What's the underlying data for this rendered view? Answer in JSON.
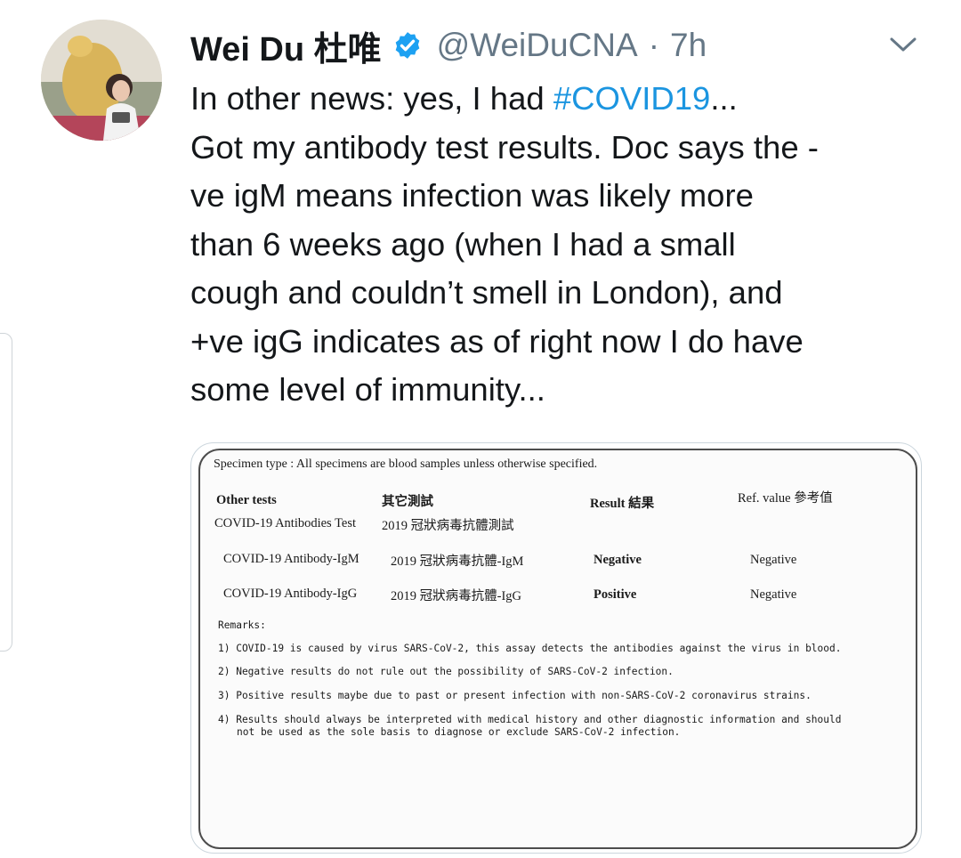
{
  "author": {
    "display_name": "Wei Du 杜唯",
    "handle": "@WeiDuCNA",
    "separator": "·",
    "time": "7h"
  },
  "tweet": {
    "lines": [
      [
        "In other news: yes, I had ",
        "#COVID19",
        "..."
      ],
      [
        "Got my antibody test results. Doc says the -"
      ],
      [
        "ve igM means infection was likely more"
      ],
      [
        "than 6 weeks ago (when I had a small"
      ],
      [
        "cough and couldn’t smell in London), and"
      ],
      [
        "+ve igG indicates as of right now I do have"
      ],
      [
        "some level of immunity..."
      ]
    ]
  },
  "report": {
    "specimen_note": "Specimen type : All specimens are blood samples unless otherwise specified.",
    "headers": {
      "tests": "Other tests",
      "tests_cn": "其它測試",
      "result": "Result 結果",
      "ref": "Ref. value 參考值"
    },
    "group_name": "COVID-19 Antibodies Test",
    "group_name_cn": "2019 冠狀病毒抗體測試",
    "rows": [
      {
        "test": "COVID-19 Antibody-IgM",
        "test_cn": "2019 冠狀病毒抗體-IgM",
        "result": "Negative",
        "ref": "Negative"
      },
      {
        "test": "COVID-19 Antibody-IgG",
        "test_cn": "2019 冠狀病毒抗體-IgG",
        "result": "Positive",
        "ref": "Negative"
      }
    ],
    "remarks_label": "Remarks:",
    "remarks": [
      "1) COVID-19 is caused by virus SARS-CoV-2, this assay detects the antibodies against the virus in blood.",
      "2) Negative results do not rule out the possibility of SARS-CoV-2 infection.",
      "3) Positive results maybe due to past or present infection with non-SARS-CoV-2 coronavirus strains.",
      "4) Results should always be interpreted with medical history and other diagnostic information and should",
      "not be used as the sole basis to diagnose or exclude SARS-CoV-2 infection."
    ]
  },
  "colors": {
    "text": "#14171a",
    "secondary": "#657786",
    "link": "#1b95e0",
    "verified": "#1da1f2",
    "border": "#ccd6dd"
  },
  "icons": {
    "verified": "verified-badge-icon",
    "menu": "chevron-down-icon"
  }
}
